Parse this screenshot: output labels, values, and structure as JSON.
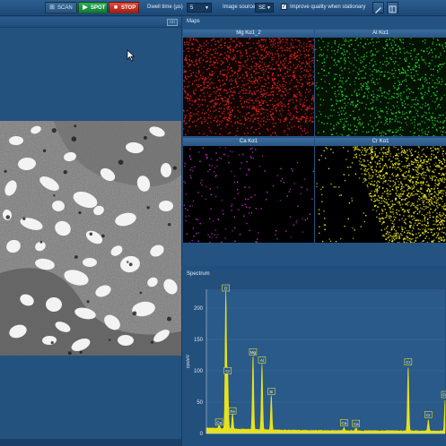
{
  "toolbar": {
    "scan_label": "SCAN",
    "spot_label": "SPOT",
    "stop_label": "STOP",
    "dwell_label": "Dwell time (µs)",
    "dwell_value": "5",
    "source_label": "Image source:",
    "source_value": "SE",
    "improve_label": "Improve quality when stationary",
    "improve_checked": true
  },
  "maps": {
    "panel_label": "Maps",
    "items": [
      {
        "label": "Mg Kα1_2",
        "color": "#e3261f"
      },
      {
        "label": "Al Kα1",
        "color": "#2bd62b"
      },
      {
        "label": "Ca Kα1",
        "color": "#d62fe0"
      },
      {
        "label": "Cr Kα1",
        "color": "#f2ee1d"
      }
    ]
  },
  "spectrum": {
    "panel_label": "Spectrum",
    "ylabel": "cps/eV",
    "line_color": "#e8e21c"
  },
  "chart_data": {
    "type": "area",
    "title": "",
    "ylabel": "cps/eV",
    "xlabel": "",
    "ylim": [
      0,
      230
    ],
    "xlim": [
      0,
      6.4
    ],
    "y_ticks": [
      0,
      50,
      100,
      150,
      200
    ],
    "peaks": [
      {
        "label": "O",
        "x": 0.52,
        "y": 220
      },
      {
        "label": "Cr",
        "x": 0.57,
        "y": 88
      },
      {
        "label": "Fe",
        "x": 0.7,
        "y": 24
      },
      {
        "label": "Mg",
        "x": 1.25,
        "y": 118
      },
      {
        "label": "Al",
        "x": 1.49,
        "y": 105
      },
      {
        "label": "Si",
        "x": 1.74,
        "y": 55
      },
      {
        "label": "Ca",
        "x": 3.69,
        "y": 5
      },
      {
        "label": "Ca",
        "x": 4.01,
        "y": 4
      },
      {
        "label": "Cr",
        "x": 5.41,
        "y": 102
      },
      {
        "label": "Cr",
        "x": 5.95,
        "y": 18
      },
      {
        "label": "Fe",
        "x": 6.4,
        "y": 50
      },
      {
        "label": "Ca",
        "x": 0.34,
        "y": 6
      }
    ]
  }
}
